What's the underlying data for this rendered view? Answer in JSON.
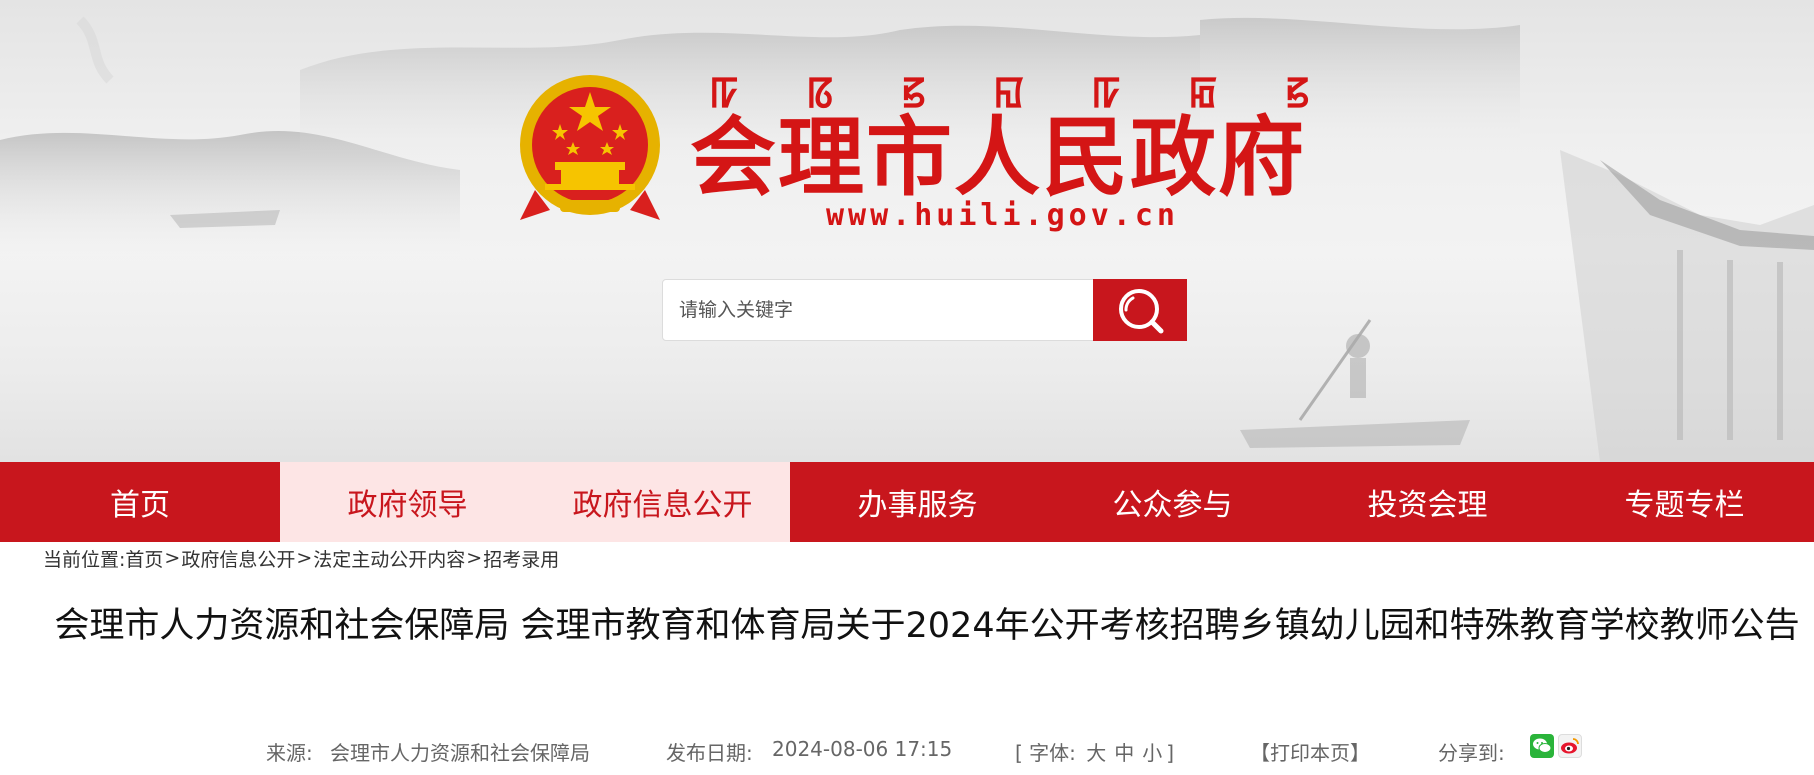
{
  "header": {
    "mongolian_script": [
      "ꡠ",
      "ꡞ",
      "ꡝ",
      "ꡎ",
      "ꡠ",
      "ꡂ",
      "ꡝ"
    ],
    "site_title": "会理市人民政府",
    "site_url": "www.huili.gov.cn"
  },
  "search": {
    "placeholder": "请输入关键字",
    "value": ""
  },
  "nav": {
    "items": [
      {
        "label": "首页",
        "active": false
      },
      {
        "label": "政府领导",
        "active": true
      },
      {
        "label": "政府信息公开",
        "active": true
      },
      {
        "label": "办事服务",
        "active": false
      },
      {
        "label": "公众参与",
        "active": false
      },
      {
        "label": "投资会理",
        "active": false
      },
      {
        "label": "专题专栏",
        "active": false
      }
    ]
  },
  "breadcrumb": {
    "prefix": "当前位置:",
    "items": [
      "首页",
      "政府信息公开",
      "法定主动公开内容",
      "招考录用"
    ],
    "separator": ">"
  },
  "article": {
    "title": "会理市人力资源和社会保障局 会理市教育和体育局关于2024年公开考核招聘乡镇幼儿园和特殊教育学校教师公告",
    "source_label": "来源:",
    "source": "会理市人力资源和社会保障局",
    "date_label": "发布日期:",
    "date": "2024-08-06 17:15",
    "font_size_open": "[ 字体:",
    "font_large": "大",
    "font_medium": "中",
    "font_small": "小",
    "font_size_close": "]",
    "print_label": "【打印本页】",
    "share_label": "分享到:"
  },
  "colors": {
    "brand_red": "#c8161d",
    "title_red": "#d41515",
    "nav_active_bg": "#fde5e5",
    "wechat_green": "#2ab43a",
    "weibo_red": "#e6162d"
  },
  "icons": {
    "search": "search-icon",
    "emblem": "national-emblem-icon",
    "wechat": "wechat-icon",
    "weibo": "weibo-icon"
  }
}
